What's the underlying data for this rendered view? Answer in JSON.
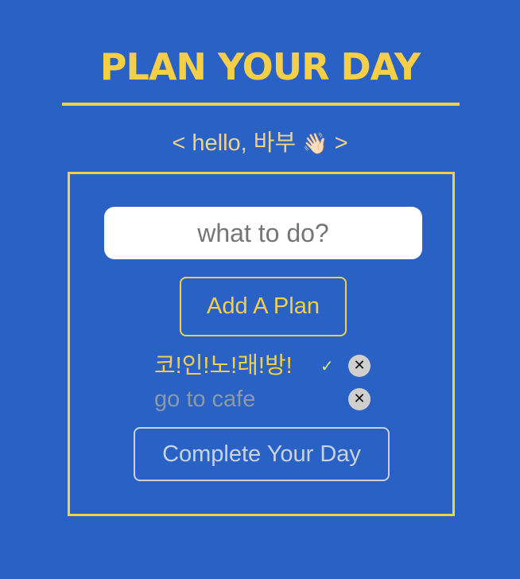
{
  "header": {
    "title": "PLAN YOUR DAY",
    "greeting_prefix": "< hello, 바부 ",
    "greeting_emoji": "👋🏻",
    "greeting_suffix": " >"
  },
  "form": {
    "input_placeholder": "what to do?",
    "input_value": "",
    "add_button_label": "Add A Plan"
  },
  "plans": [
    {
      "text": "코!인!노!래!방!",
      "checked": true,
      "check_mark": "✓",
      "delete_glyph": "✕"
    },
    {
      "text": "go to cafe",
      "checked": false,
      "check_mark": "",
      "delete_glyph": "✕"
    }
  ],
  "footer": {
    "complete_button_label": "Complete Your Day"
  },
  "colors": {
    "background": "#2962c4",
    "accent": "#f6cf49",
    "muted_text": "#8c9aa8",
    "check": "#d9ef7a"
  }
}
